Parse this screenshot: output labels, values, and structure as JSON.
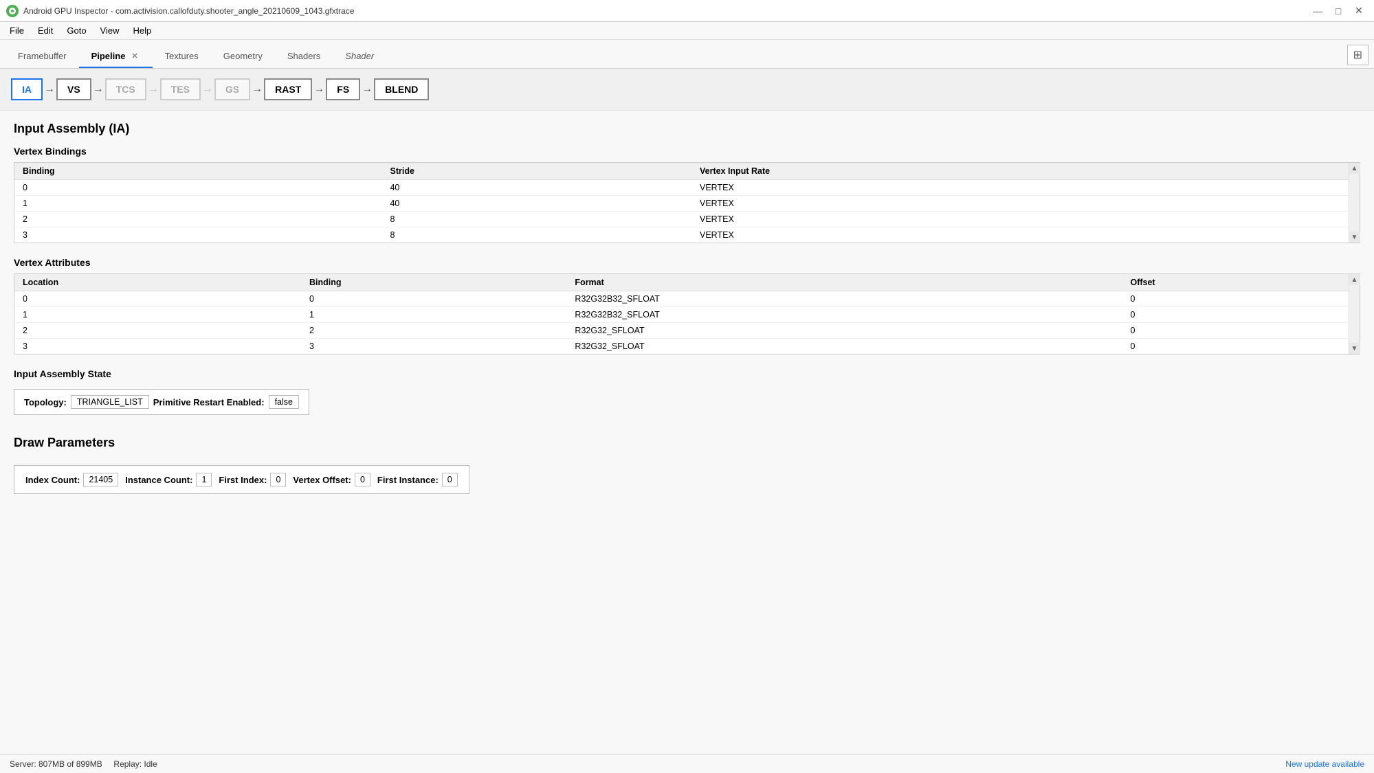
{
  "titleBar": {
    "title": "Android GPU Inspector - com.activision.callofduty.shooter_angle_20210609_1043.gfxtrace",
    "minBtn": "—",
    "maxBtn": "□",
    "closeBtn": "✕"
  },
  "menuBar": {
    "items": [
      "File",
      "Edit",
      "Goto",
      "View",
      "Help"
    ]
  },
  "tabs": [
    {
      "id": "framebuffer",
      "label": "Framebuffer",
      "active": false,
      "closeable": false
    },
    {
      "id": "pipeline",
      "label": "Pipeline",
      "active": true,
      "closeable": true
    },
    {
      "id": "textures",
      "label": "Textures",
      "active": false,
      "closeable": false
    },
    {
      "id": "geometry",
      "label": "Geometry",
      "active": false,
      "closeable": false
    },
    {
      "id": "shaders",
      "label": "Shaders",
      "active": false,
      "closeable": false
    },
    {
      "id": "shader",
      "label": "Shader",
      "active": false,
      "closeable": false,
      "italic": true
    }
  ],
  "pipeline": {
    "stages": [
      {
        "id": "IA",
        "label": "IA",
        "active": true,
        "disabled": false
      },
      {
        "id": "VS",
        "label": "VS",
        "active": false,
        "disabled": false
      },
      {
        "id": "TCS",
        "label": "TCS",
        "active": false,
        "disabled": true
      },
      {
        "id": "TES",
        "label": "TES",
        "active": false,
        "disabled": true
      },
      {
        "id": "GS",
        "label": "GS",
        "active": false,
        "disabled": true
      },
      {
        "id": "RAST",
        "label": "RAST",
        "active": false,
        "disabled": false
      },
      {
        "id": "FS",
        "label": "FS",
        "active": false,
        "disabled": false
      },
      {
        "id": "BLEND",
        "label": "BLEND",
        "active": false,
        "disabled": false
      }
    ]
  },
  "inputAssembly": {
    "sectionTitle": "Input Assembly (IA)",
    "vertexBindings": {
      "title": "Vertex Bindings",
      "columns": [
        "Binding",
        "Stride",
        "Vertex Input Rate"
      ],
      "rows": [
        [
          "0",
          "40",
          "VERTEX"
        ],
        [
          "1",
          "40",
          "VERTEX"
        ],
        [
          "2",
          "8",
          "VERTEX"
        ],
        [
          "3",
          "8",
          "VERTEX"
        ]
      ]
    },
    "vertexAttributes": {
      "title": "Vertex Attributes",
      "columns": [
        "Location",
        "Binding",
        "Format",
        "Offset"
      ],
      "rows": [
        [
          "0",
          "0",
          "R32G32B32_SFLOAT",
          "0"
        ],
        [
          "1",
          "1",
          "R32G32B32_SFLOAT",
          "0"
        ],
        [
          "2",
          "2",
          "R32G32_SFLOAT",
          "0"
        ],
        [
          "3",
          "3",
          "R32G32_SFLOAT",
          "0"
        ]
      ]
    },
    "assemblyState": {
      "title": "Input Assembly State",
      "topologyLabel": "Topology:",
      "topologyValue": "TRIANGLE_LIST",
      "primitiveLabel": "Primitive Restart Enabled:",
      "primitiveValue": "false"
    }
  },
  "drawParameters": {
    "title": "Draw Parameters",
    "indexCountLabel": "Index Count:",
    "indexCountValue": "21405",
    "instanceCountLabel": "Instance Count:",
    "instanceCountValue": "1",
    "firstIndexLabel": "First Index:",
    "firstIndexValue": "0",
    "vertexOffsetLabel": "Vertex Offset:",
    "vertexOffsetValue": "0",
    "firstInstanceLabel": "First Instance:",
    "firstInstanceValue": "0"
  },
  "statusBar": {
    "serverInfo": "Server: 807MB of 899MB",
    "replayInfo": "Replay: Idle",
    "updateText": "New update available"
  }
}
